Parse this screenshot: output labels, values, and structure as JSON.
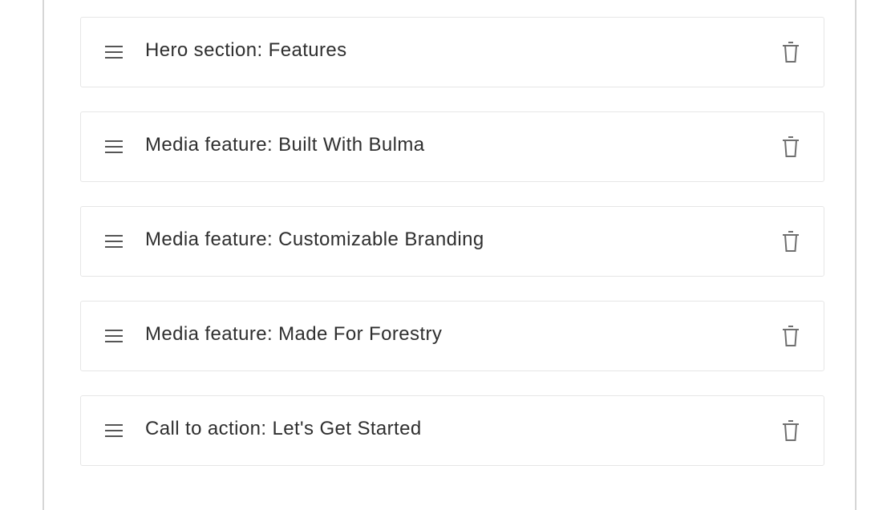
{
  "items": [
    {
      "label": "Hero section: Features"
    },
    {
      "label": "Media feature: Built With Bulma"
    },
    {
      "label": "Media feature: Customizable Branding"
    },
    {
      "label": "Media feature: Made For Forestry"
    },
    {
      "label": "Call to action: Let's Get Started"
    }
  ],
  "icons": {
    "drag": "drag-handle-icon",
    "delete": "trash-icon"
  },
  "colors": {
    "text": "#2f2f2f",
    "icon": "#6f6f6f",
    "border": "#e6e6e6"
  }
}
